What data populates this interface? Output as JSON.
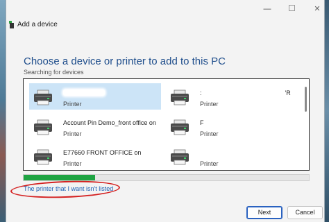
{
  "window": {
    "title": "Add a device"
  },
  "heading": "Choose a device or printer to add to this PC",
  "status": "Searching for devices",
  "devices": [
    {
      "name": "",
      "type": "Printer",
      "selected": true
    },
    {
      "name": ":",
      "name_suffix": "'R",
      "type": "Printer",
      "selected": false
    },
    {
      "name": "Account Pin Demo_front office on",
      "type": "Printer",
      "selected": false
    },
    {
      "name": "F",
      "type": "Printer",
      "selected": false
    },
    {
      "name": "E77660 FRONT OFFICE on",
      "type": "Printer",
      "selected": false
    },
    {
      "name": "",
      "type": "Printer",
      "selected": false
    }
  ],
  "progress": {
    "fraction": 0.25,
    "color": "#1fa443"
  },
  "link": "The printer that I want isn't listed",
  "buttons": {
    "next": "Next",
    "cancel": "Cancel"
  },
  "icons": {
    "app": "printer-icon",
    "device": "printer-icon"
  }
}
